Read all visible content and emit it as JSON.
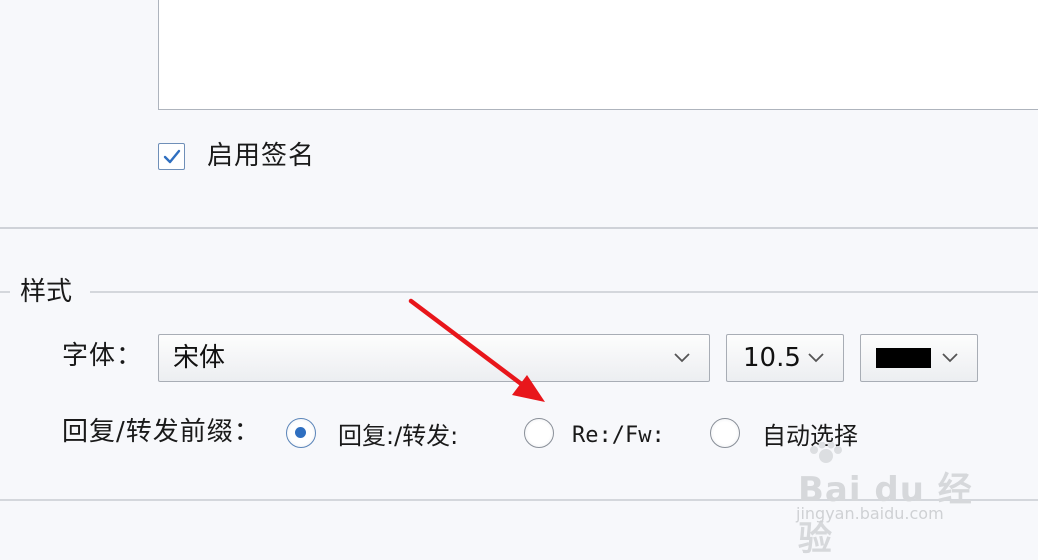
{
  "signature": {
    "enable_label": "启用签名",
    "enabled": true
  },
  "style_group": {
    "title": "样式",
    "font_label": "字体：",
    "font_value": "宋体",
    "size_value": "10.5",
    "color_value": "#000000",
    "prefix_label": "回复/转发前缀：",
    "prefix_options": [
      {
        "label": "回复:/转发:",
        "checked": true
      },
      {
        "label": "Re:/Fw:",
        "checked": false
      },
      {
        "label": "自动选择",
        "checked": false
      }
    ]
  },
  "annotation": {
    "arrow_color": "#e8161b"
  },
  "watermark": {
    "brand": "Bai du 经验",
    "url": "jingyan.baidu.com"
  },
  "colors": {
    "background": "#f7f8fb",
    "accent": "#2f6fc0",
    "arrow": "#e8161b"
  }
}
